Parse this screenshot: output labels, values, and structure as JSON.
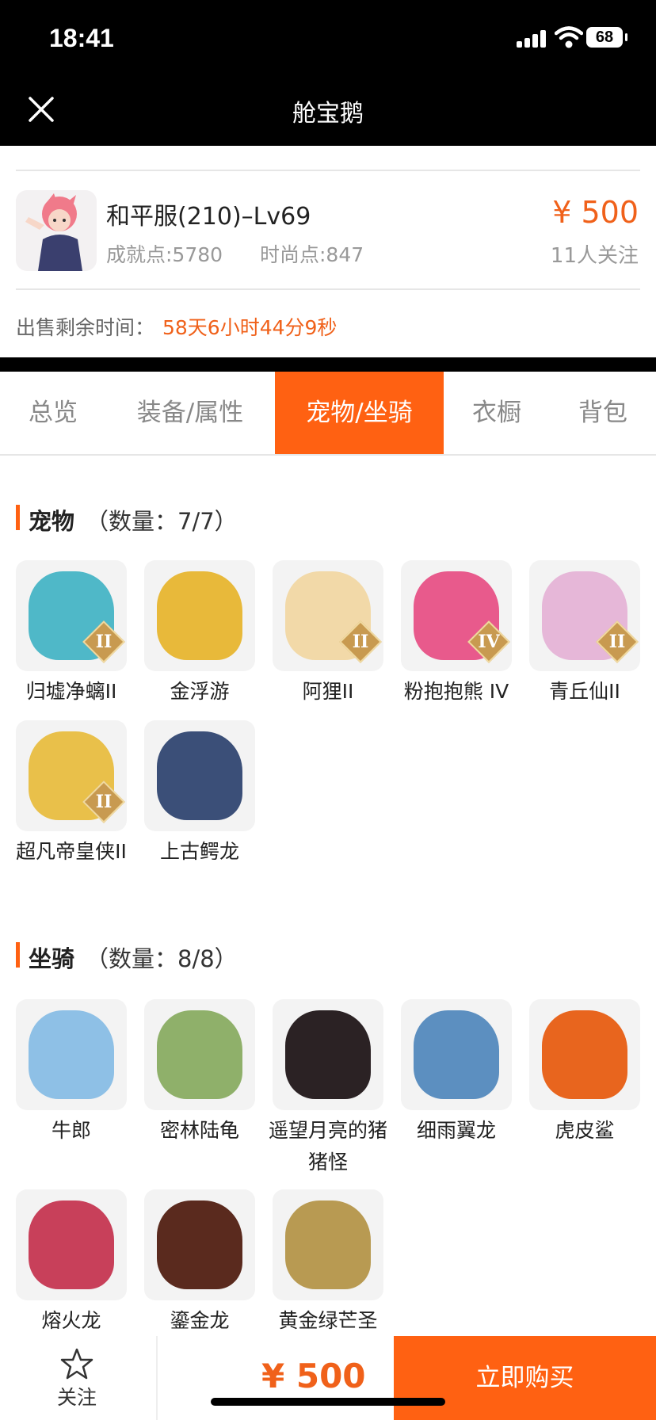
{
  "status": {
    "time": "18:41",
    "battery": "68"
  },
  "nav": {
    "title": "舱宝鹅"
  },
  "listing": {
    "server": "和平服(210)–Lv69",
    "achievement": "成就点:5780",
    "fashion": "时尚点:847",
    "price": "¥ 500",
    "followers": "11人关注",
    "sale_label": "出售剩余时间：",
    "sale_time": "58天6小时44分9秒"
  },
  "tabs": [
    "总览",
    "装备/属性",
    "宠物/坐骑",
    "衣橱",
    "背包"
  ],
  "pets": {
    "title": "宠物",
    "count": "（数量：7/7）",
    "items": [
      {
        "name": "归墟净螭II",
        "grade": "II",
        "color": "#4fb8c8"
      },
      {
        "name": "金浮游",
        "grade": "",
        "color": "#e8b93a"
      },
      {
        "name": "阿狸II",
        "grade": "II",
        "color": "#f2d9a8"
      },
      {
        "name": "粉抱抱熊 IV",
        "grade": "IV",
        "color": "#e85a8c"
      },
      {
        "name": "青丘仙II",
        "grade": "II",
        "color": "#e6b7d8"
      },
      {
        "name": "超凡帝皇侠II",
        "grade": "II",
        "color": "#e9c04a"
      },
      {
        "name": "上古鳄龙",
        "grade": "",
        "color": "#3b4f78"
      }
    ]
  },
  "mounts": {
    "title": "坐骑",
    "count": "（数量：8/8）",
    "items": [
      {
        "name": "牛郎",
        "color": "#8ec0e6"
      },
      {
        "name": "密林陆龟",
        "color": "#8fb06a"
      },
      {
        "name": "遥望月亮的猪猪怪",
        "color": "#2b2224"
      },
      {
        "name": "细雨翼龙",
        "color": "#5c8fc0"
      },
      {
        "name": "虎皮鲨",
        "color": "#e8651e"
      },
      {
        "name": "熔火龙",
        "color": "#c8405a"
      },
      {
        "name": "鎏金龙",
        "color": "#5a2a1e"
      },
      {
        "name": "黄金绿芒圣",
        "color": "#b89a52"
      }
    ]
  },
  "bottom": {
    "follow": "关注",
    "price": "¥ 500",
    "buy": "立即购买"
  }
}
